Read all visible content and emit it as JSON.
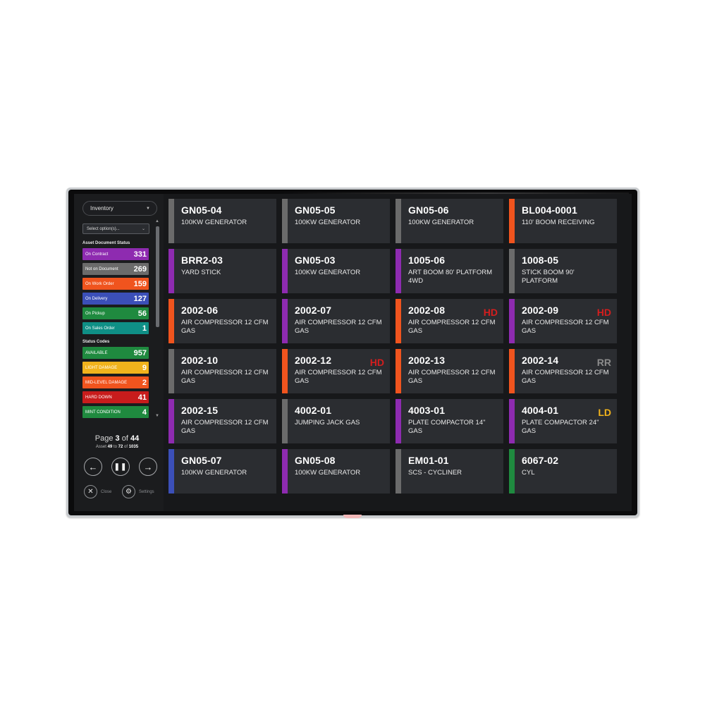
{
  "sidebar": {
    "dropdown": {
      "label": "Inventory"
    },
    "select": {
      "placeholder": "Select option(s)..."
    },
    "doc_status_title": "Asset Document Status",
    "doc_status": [
      {
        "label": "On Contract",
        "count": "331",
        "color": "#8e2bb0"
      },
      {
        "label": "Not on Document",
        "count": "269",
        "color": "#6b6b6b"
      },
      {
        "label": "On Work Order",
        "count": "159",
        "color": "#f0541e"
      },
      {
        "label": "On Delivery",
        "count": "127",
        "color": "#3b4fb8"
      },
      {
        "label": "On Pickup",
        "count": "56",
        "color": "#1f8a3f"
      },
      {
        "label": "On Sales Order",
        "count": "1",
        "color": "#0f8f86"
      }
    ],
    "status_codes_title": "Status Codes",
    "status_codes": [
      {
        "label": "AVAILABLE",
        "count": "957",
        "color": "#1f8a3f"
      },
      {
        "label": "LIGHT DAMAGE",
        "count": "9",
        "color": "#f1b31c"
      },
      {
        "label": "MID-LEVEL DAMAGE",
        "count": "2",
        "color": "#f0541e"
      },
      {
        "label": "HARD DOWN",
        "count": "41",
        "color": "#c81c1c"
      },
      {
        "label": "MINT CONDITION",
        "count": "4",
        "color": "#1f8a3f"
      }
    ],
    "pager": {
      "page_prefix": "Page",
      "page_current": "3",
      "page_of": "of",
      "page_total": "44",
      "asset_prefix": "Asset",
      "asset_from": "49",
      "asset_to_word": "to",
      "asset_to": "72",
      "asset_of_word": "of",
      "asset_total": "1035"
    },
    "controls": {
      "close_label": "Close",
      "settings_label": "Settings"
    }
  },
  "cards": [
    {
      "code": "GN05-04",
      "desc": "100KW GENERATOR",
      "bar": "#6b6b6b",
      "tag": "",
      "tag_color": ""
    },
    {
      "code": "GN05-05",
      "desc": "100KW GENERATOR",
      "bar": "#6b6b6b",
      "tag": "",
      "tag_color": ""
    },
    {
      "code": "GN05-06",
      "desc": "100KW GENERATOR",
      "bar": "#6b6b6b",
      "tag": "",
      "tag_color": ""
    },
    {
      "code": "BL004-0001",
      "desc": "110' BOOM RECEIVING",
      "bar": "#f0541e",
      "tag": "",
      "tag_color": ""
    },
    {
      "code": "BRR2-03",
      "desc": "YARD STICK",
      "bar": "#8e2bb0",
      "tag": "",
      "tag_color": ""
    },
    {
      "code": "GN05-03",
      "desc": "100KW GENERATOR",
      "bar": "#8e2bb0",
      "tag": "",
      "tag_color": ""
    },
    {
      "code": "1005-06",
      "desc": "ART BOOM 80' PLATFORM 4WD",
      "bar": "#8e2bb0",
      "tag": "",
      "tag_color": ""
    },
    {
      "code": "1008-05",
      "desc": "STICK BOOM 90' PLATFORM",
      "bar": "#6b6b6b",
      "tag": "",
      "tag_color": ""
    },
    {
      "code": "2002-06",
      "desc": "AIR COMPRESSOR 12 CFM GAS",
      "bar": "#f0541e",
      "tag": "",
      "tag_color": ""
    },
    {
      "code": "2002-07",
      "desc": "AIR COMPRESSOR 12 CFM GAS",
      "bar": "#8e2bb0",
      "tag": "",
      "tag_color": ""
    },
    {
      "code": "2002-08",
      "desc": "AIR COMPRESSOR 12 CFM GAS",
      "bar": "#f0541e",
      "tag": "HD",
      "tag_color": "#d41e1e"
    },
    {
      "code": "2002-09",
      "desc": "AIR COMPRESSOR 12 CFM GAS",
      "bar": "#8e2bb0",
      "tag": "HD",
      "tag_color": "#d41e1e"
    },
    {
      "code": "2002-10",
      "desc": "AIR COMPRESSOR 12 CFM GAS",
      "bar": "#6b6b6b",
      "tag": "",
      "tag_color": ""
    },
    {
      "code": "2002-12",
      "desc": "AIR COMPRESSOR 12 CFM GAS",
      "bar": "#f0541e",
      "tag": "HD",
      "tag_color": "#d41e1e"
    },
    {
      "code": "2002-13",
      "desc": "AIR COMPRESSOR 12 CFM GAS",
      "bar": "#f0541e",
      "tag": "",
      "tag_color": ""
    },
    {
      "code": "2002-14",
      "desc": "AIR COMPRESSOR 12 CFM GAS",
      "bar": "#f0541e",
      "tag": "RR",
      "tag_color": "#8c8c8c"
    },
    {
      "code": "2002-15",
      "desc": "AIR COMPRESSOR 12 CFM GAS",
      "bar": "#8e2bb0",
      "tag": "",
      "tag_color": ""
    },
    {
      "code": "4002-01",
      "desc": "JUMPING JACK GAS",
      "bar": "#6b6b6b",
      "tag": "",
      "tag_color": ""
    },
    {
      "code": "4003-01",
      "desc": "PLATE COMPACTOR 14\" GAS",
      "bar": "#8e2bb0",
      "tag": "",
      "tag_color": ""
    },
    {
      "code": "4004-01",
      "desc": "PLATE COMPACTOR 24\" GAS",
      "bar": "#8e2bb0",
      "tag": "LD",
      "tag_color": "#f1b31c"
    },
    {
      "code": "GN05-07",
      "desc": "100KW GENERATOR",
      "bar": "#3b4fb8",
      "tag": "",
      "tag_color": ""
    },
    {
      "code": "GN05-08",
      "desc": "100KW GENERATOR",
      "bar": "#8e2bb0",
      "tag": "",
      "tag_color": ""
    },
    {
      "code": "EM01-01",
      "desc": "SCS - CYCLINER",
      "bar": "#6b6b6b",
      "tag": "",
      "tag_color": ""
    },
    {
      "code": "6067-02",
      "desc": "CYL",
      "bar": "#1f8a3f",
      "tag": "",
      "tag_color": ""
    }
  ]
}
